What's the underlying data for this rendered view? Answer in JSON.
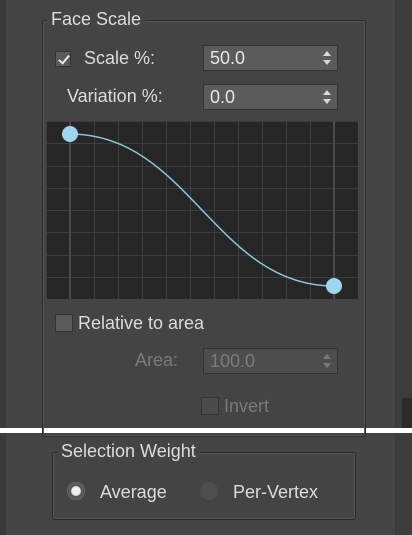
{
  "face_scale": {
    "title": "Face Scale",
    "scale": {
      "checked": true,
      "label": "Scale %:",
      "value": "50.0"
    },
    "variation": {
      "label": "Variation %:",
      "value": "0.0"
    },
    "curve": {
      "points": [
        [
          0,
          1
        ],
        [
          1,
          0
        ]
      ]
    },
    "relative_to_area": {
      "checked": false,
      "label": "Relative to area"
    },
    "area": {
      "label": "Area:",
      "value": "100.0"
    },
    "invert": {
      "checked": false,
      "label": "Invert"
    }
  },
  "selection_weight": {
    "title": "Selection Weight",
    "options": [
      {
        "label": "Average",
        "selected": true
      },
      {
        "label": "Per-Vertex",
        "selected": false
      }
    ]
  },
  "colors": {
    "curve_line": "#8cc4d8",
    "curve_point": "#9fd6ee",
    "grid": "#3d3d3d"
  }
}
